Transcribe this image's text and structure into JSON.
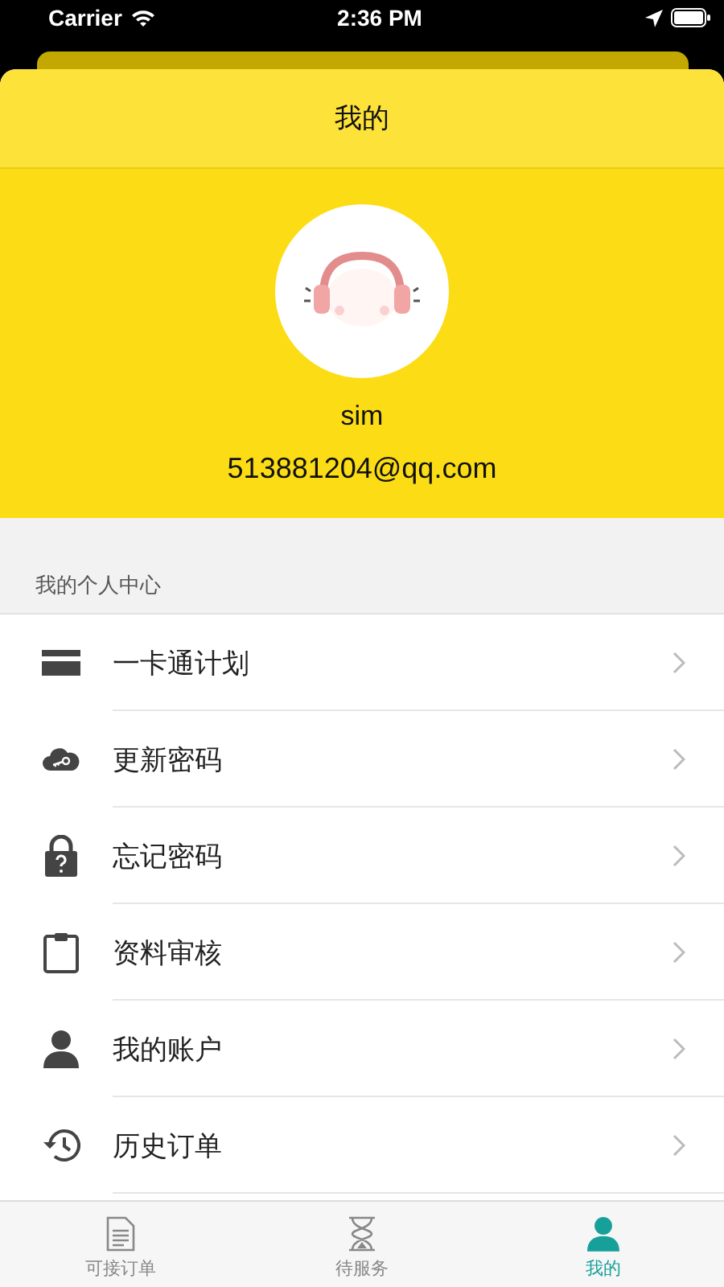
{
  "status_bar": {
    "carrier": "Carrier",
    "time": "2:36 PM"
  },
  "header": {
    "title": "我的"
  },
  "profile": {
    "name": "sim",
    "email": "513881204@qq.com"
  },
  "section_label": "我的个人中心",
  "menu": [
    {
      "kind": "card",
      "label": "一卡通计划"
    },
    {
      "kind": "cloud-key",
      "label": "更新密码"
    },
    {
      "kind": "lock",
      "label": "忘记密码"
    },
    {
      "kind": "clipboard",
      "label": "资料审核"
    },
    {
      "kind": "person",
      "label": "我的账户"
    },
    {
      "kind": "history",
      "label": "历史订单"
    }
  ],
  "tabs": [
    {
      "kind": "document",
      "label": "可接订单",
      "selected": false
    },
    {
      "kind": "hourglass",
      "label": "待服务",
      "selected": false
    },
    {
      "kind": "person",
      "label": "我的",
      "selected": true
    }
  ]
}
